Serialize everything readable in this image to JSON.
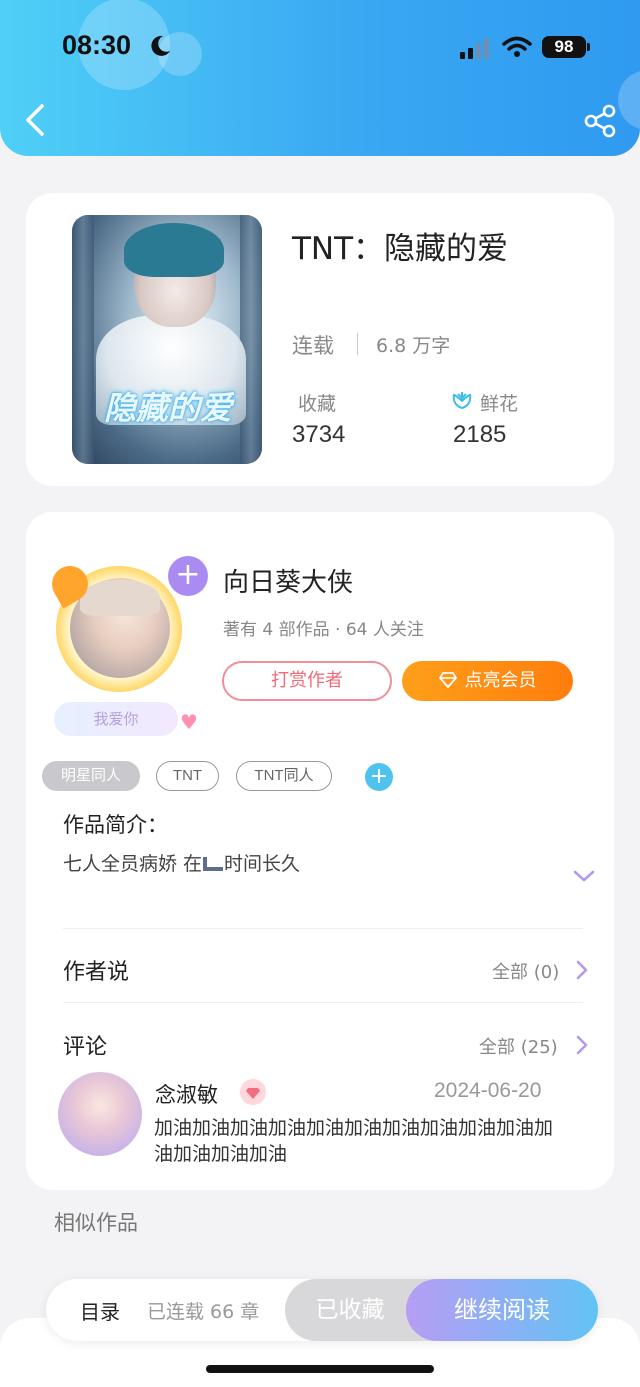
{
  "status_bar": {
    "time": "08:30",
    "battery": "98"
  },
  "book": {
    "title": "TNT：隐藏的爱",
    "cover_title": "隐藏的爱",
    "status": "连载",
    "word_count": "6.8 万字",
    "stats": [
      {
        "label": "收藏",
        "value": "3734"
      },
      {
        "label": "鲜花",
        "value": "2185"
      }
    ]
  },
  "author": {
    "name": "向日葵大侠",
    "meta": "著有 4 部作品 · 64 人关注",
    "avatar_tag": "我爱你",
    "tip_label": "打赏作者",
    "vip_label": "点亮会员"
  },
  "tags": [
    "明星同人",
    "TNT",
    "TNT同人"
  ],
  "intro": {
    "heading": "作品简介：",
    "text_before": "七人全员病娇 在",
    "text_after": "时间长久"
  },
  "author_says": {
    "title": "作者说",
    "all": "全部 (0)"
  },
  "comments": {
    "title": "评论",
    "all": "全部 (25)",
    "first": {
      "user": "念淑敏",
      "date": "2024-06-20",
      "text": "加油加油加油加油加油加油加油加油加油加油加油加油加油加油"
    }
  },
  "similar_title": "相似作品",
  "bottom_bar": {
    "toc": "目录",
    "chapters": "已连载 66 章",
    "collected": "已收藏",
    "continue": "继续阅读"
  },
  "colors": {
    "header_start": "#4fd0f7",
    "header_end": "#2f9af0",
    "vip_orange": "#ff8a12",
    "tip_pink": "#ee6b79",
    "read_start": "#b79df4",
    "read_end": "#61c3f4"
  }
}
